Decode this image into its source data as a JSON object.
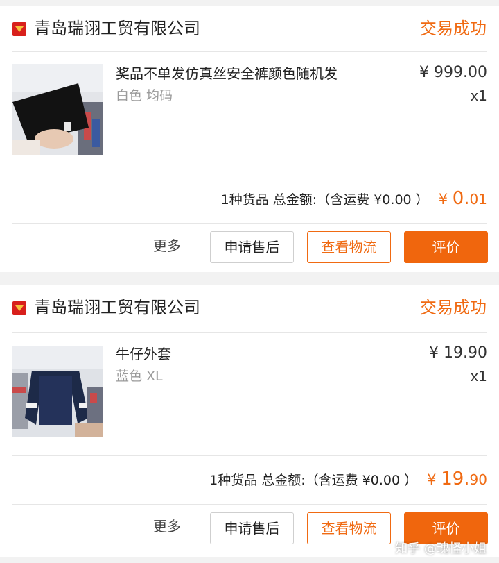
{
  "orders": [
    {
      "shop_name": "青岛瑞诩工贸有限公司",
      "status": "交易成功",
      "item": {
        "title": "奖品不单发仿真丝安全裤颜色随机发",
        "spec": "白色 均码",
        "price": "¥ 999.00",
        "qty": "x1"
      },
      "summary": {
        "text": "1种货品 总金额:（含运费 ¥0.00 ）",
        "amount_symbol": "¥ ",
        "amount_int": "0.",
        "amount_dec": "01"
      },
      "actions": {
        "more": "更多",
        "after_sale": "申请售后",
        "logistics": "查看物流",
        "review": "评价"
      }
    },
    {
      "shop_name": "青岛瑞诩工贸有限公司",
      "status": "交易成功",
      "item": {
        "title": "牛仔外套",
        "spec": "蓝色 XL",
        "price": "¥ 19.90",
        "qty": "x1"
      },
      "summary": {
        "text": "1种货品 总金额:（含运费 ¥0.00 ）",
        "amount_symbol": "¥ ",
        "amount_int": "19.",
        "amount_dec": "90"
      },
      "actions": {
        "more": "更多",
        "after_sale": "申请售后",
        "logistics": "查看物流",
        "review": "评价"
      }
    }
  ],
  "watermark": "知乎 @瑰怪小姐",
  "colors": {
    "accent": "#f06a12",
    "button_fill": "#f0660d",
    "shop_icon": "#d8201c"
  }
}
